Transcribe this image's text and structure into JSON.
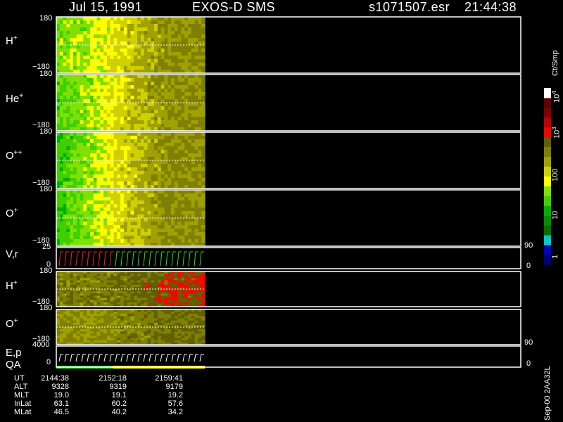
{
  "header": {
    "date": "Jul 15, 1991",
    "mission": "EXOS-D SMS",
    "file": "s1071507.esr",
    "time": "21:44:38"
  },
  "panels": [
    {
      "id": "h-plus",
      "species": "H",
      "charge": "+",
      "top": "180",
      "bottom": "−180"
    },
    {
      "id": "he-plus",
      "species": "He",
      "charge": "+",
      "top": "180",
      "bottom": "−180"
    },
    {
      "id": "o-plusplus",
      "species": "O",
      "charge": "++",
      "top": "180",
      "bottom": "−180"
    },
    {
      "id": "o-plus",
      "species": "O",
      "charge": "+",
      "top": "180",
      "bottom": "−180"
    },
    {
      "id": "vr",
      "label": "V,r",
      "top": "25",
      "bottom": "0",
      "right_top": "90",
      "right_bottom": "0"
    },
    {
      "id": "h-plus-2",
      "species": "H",
      "charge": "+",
      "top": "180",
      "bottom": "−180"
    },
    {
      "id": "o-plus-2",
      "species": "O",
      "charge": "+",
      "top": "180",
      "bottom": "−180"
    },
    {
      "id": "ep",
      "label": "E,p",
      "label2": "QA",
      "top": "4000",
      "bottom": "0",
      "right_top": "90",
      "right_bottom": "0"
    }
  ],
  "colorbar": {
    "unit": "Ct/Smp",
    "ticks": [
      {
        "base": "10",
        "exp": "4",
        "rotated": true
      },
      {
        "base": "10",
        "exp": "3",
        "rotated": true
      },
      {
        "base": "100",
        "exp": "",
        "rotated": true
      },
      {
        "base": "10",
        "exp": "",
        "rotated": true
      },
      {
        "base": "1",
        "exp": "",
        "rotated": true
      }
    ],
    "colors": [
      "#000080",
      "#0000c8",
      "#00c8c8",
      "#007000",
      "#009000",
      "#00b000",
      "#40d000",
      "#80e000",
      "#ffff00",
      "#d0d000",
      "#a0a000",
      "#808000",
      "#606000",
      "#ff0000",
      "#c00000",
      "#800000",
      "#600000",
      "#ffffff"
    ]
  },
  "footer_note": "Sep-00 2AA32L",
  "ephemeris": {
    "labels": [
      "UT",
      "ALT",
      "MLT",
      "InLat",
      "MLat"
    ],
    "columns": [
      [
        "2144:38",
        "9328",
        "19.0",
        "63.1",
        "46.5"
      ],
      [
        "2152:18",
        "9319",
        "19.1",
        "60.2",
        "40.2"
      ],
      [
        "2159:41",
        "9179",
        "19.2",
        "57.6",
        "34.2"
      ]
    ]
  },
  "chart_data": {
    "type": "heatmap",
    "title": "Jul 15, 1991   EXOS-D SMS",
    "x": [
      "2144:38",
      "2152:18",
      "2159:41"
    ],
    "ylim": [
      -180,
      180
    ],
    "color_scale": {
      "unit": "Ct/Smp",
      "range": [
        1,
        10000
      ],
      "log": true
    },
    "data_extent_fraction": 0.32,
    "series": [
      {
        "name": "H+",
        "dominant_counts": [
          40,
          60,
          150,
          300,
          300
        ]
      },
      {
        "name": "He+",
        "dominant_counts": [
          30,
          50,
          150,
          300,
          300
        ]
      },
      {
        "name": "O++",
        "dominant_counts": [
          20,
          50,
          150,
          300,
          300
        ]
      },
      {
        "name": "O+",
        "dominant_counts": [
          20,
          50,
          150,
          300,
          300
        ]
      },
      {
        "name": "H+ (2)",
        "dominant_counts": [
          400,
          400,
          500,
          800,
          800
        ]
      },
      {
        "name": "O+ (2)",
        "dominant_counts": [
          300,
          300,
          400,
          500,
          500
        ]
      }
    ]
  }
}
